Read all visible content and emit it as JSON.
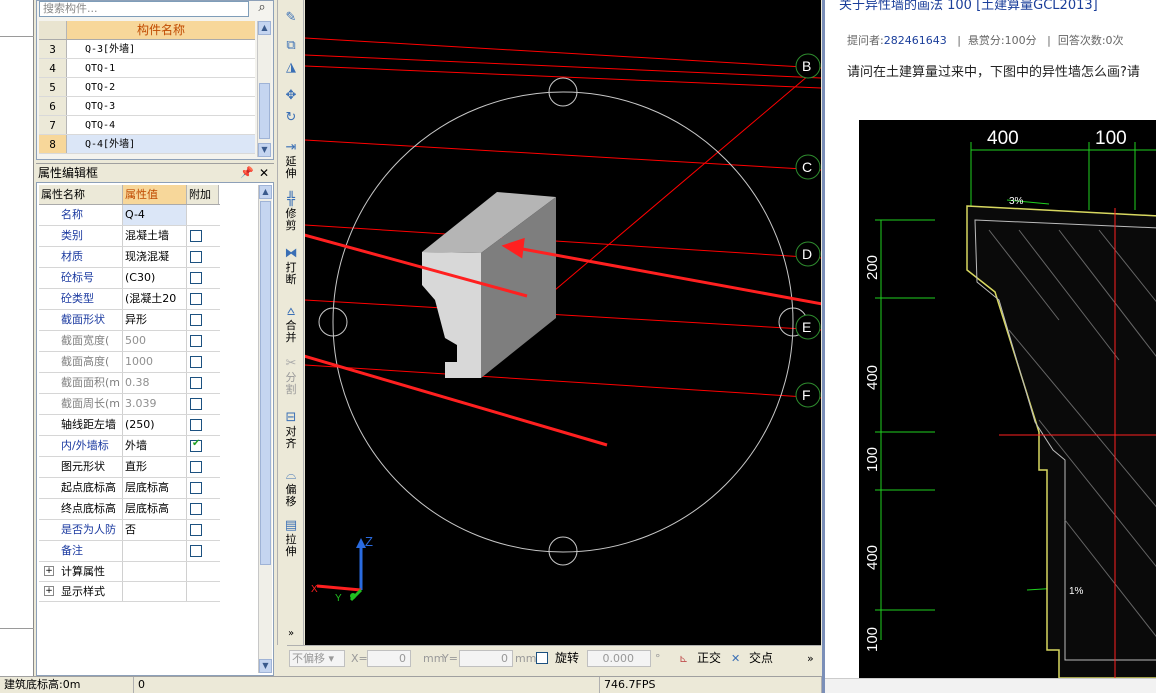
{
  "search": {
    "placeholder": "搜索构件..."
  },
  "component_list": {
    "header": "构件名称",
    "rows": [
      {
        "index": "3",
        "name": "Q-3[外墙]"
      },
      {
        "index": "4",
        "name": "QTQ-1"
      },
      {
        "index": "5",
        "name": "QTQ-2"
      },
      {
        "index": "6",
        "name": "QTQ-3"
      },
      {
        "index": "7",
        "name": "QTQ-4"
      },
      {
        "index": "8",
        "name": "Q-4[外墙]"
      }
    ]
  },
  "property_panel": {
    "title": "属性编辑框",
    "headers": {
      "name": "属性名称",
      "value": "属性值",
      "extra": "附加"
    },
    "rows": [
      {
        "name": "名称",
        "value": "Q-4"
      },
      {
        "name": "类别",
        "value": "混凝土墙"
      },
      {
        "name": "材质",
        "value": "现浇混凝"
      },
      {
        "name": "砼标号",
        "value": "(C30)"
      },
      {
        "name": "砼类型",
        "value": "(混凝土20"
      },
      {
        "name": "截面形状",
        "value": "异形"
      },
      {
        "name": "截面宽度(",
        "value": "500"
      },
      {
        "name": "截面高度(",
        "value": "1000"
      },
      {
        "name": "截面面积(m",
        "value": "0.38"
      },
      {
        "name": "截面周长(m",
        "value": "3.039"
      },
      {
        "name": "轴线距左墙",
        "value": "(250)"
      },
      {
        "name": "内/外墙标",
        "value": "外墙"
      },
      {
        "name": "图元形状",
        "value": "直形"
      },
      {
        "name": "起点底标高",
        "value": "层底标高"
      },
      {
        "name": "终点底标高",
        "value": "层底标高"
      },
      {
        "name": "是否为人防",
        "value": "否"
      },
      {
        "name": "备注",
        "value": ""
      }
    ],
    "groups": [
      "计算属性",
      "显示样式"
    ]
  },
  "tools": {
    "extend": "延伸",
    "trim": "修剪",
    "break": "打断",
    "merge": "合并",
    "split": "分割",
    "align": "对齐",
    "offset": "偏移",
    "stretch": "拉伸"
  },
  "canvas": {
    "axis_labels": [
      "B",
      "C",
      "D",
      "E",
      "F"
    ],
    "z_label": "Z",
    "y_label": "Y",
    "x_label": "X"
  },
  "canvas_toolbar": {
    "offset_select": "不偏移",
    "x_label": "X=",
    "x_value": "0",
    "y_label": "Y=",
    "y_value": "0",
    "unit": "mm",
    "rotate_label": "旋转",
    "rotate_value": "0.000",
    "degree": "°",
    "ortho": "正交",
    "intersect": "交点"
  },
  "status_bar": {
    "elevation": "建筑底标高:0m",
    "value": "0",
    "fps": "746.7FPS"
  },
  "web": {
    "title": "关于异性墙的画法  100 [土建算量GCL2013]",
    "asker_label": "提问者:",
    "asker_id": "282461643",
    "reward_label": "悬赏分:",
    "reward": "100分",
    "answers_label": "回答次数:0次",
    "question": "请问在土建算量过来中，下图中的异性墙怎么画?请",
    "dims": [
      "400",
      "100",
      "3%",
      "200",
      "400",
      "100",
      "400",
      "1%",
      "100"
    ]
  },
  "colors": {
    "accent": "#f7d79a",
    "arrow": "#ff2020",
    "cad_line": "#ff0000"
  }
}
